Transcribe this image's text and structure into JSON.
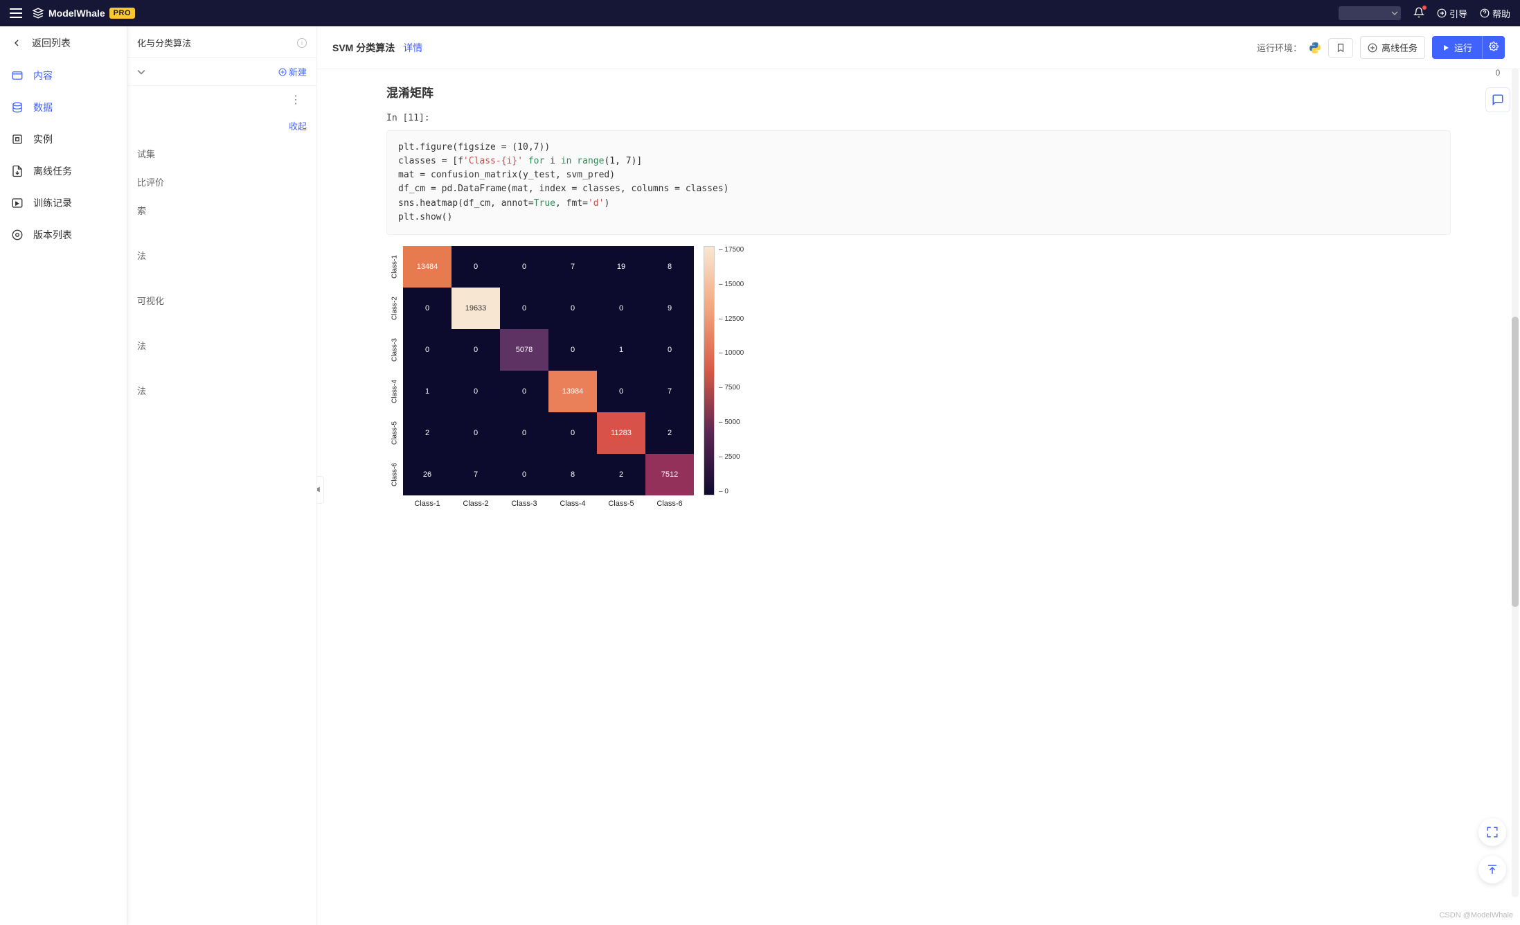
{
  "topbar": {
    "brand": "ModelWhale",
    "pro": "PRO",
    "guide": "引导",
    "help": "帮助"
  },
  "drawer": {
    "back": "返回列表",
    "items": [
      {
        "label": "内容",
        "active": true
      },
      {
        "label": "数据",
        "active": true
      },
      {
        "label": "实例",
        "active": false
      },
      {
        "label": "离线任务",
        "active": false
      },
      {
        "label": "训练记录",
        "active": false
      },
      {
        "label": "版本列表",
        "active": false
      }
    ]
  },
  "outline": {
    "title_suffix": "化与分类算法",
    "new_btn": "新建",
    "collapse": "收起",
    "items": [
      "试集",
      "比评价",
      "索",
      "法",
      "可视化",
      "法",
      "法"
    ]
  },
  "main": {
    "title": "SVM 分类算法",
    "detail": "详情",
    "env_label": "运行环境：",
    "offline_btn": "离线任务",
    "run_btn": "运行"
  },
  "notebook": {
    "heading": "混淆矩阵",
    "in_label": "In [11]:",
    "code_tokens": [
      {
        "t": "plt.figure(figsize = (",
        "c": ""
      },
      {
        "t": "10",
        "c": ""
      },
      {
        "t": ",",
        "c": ""
      },
      {
        "t": "7",
        "c": ""
      },
      {
        "t": "))\n",
        "c": ""
      },
      {
        "t": "classes = [f",
        "c": ""
      },
      {
        "t": "'Class-{i}'",
        "c": "s"
      },
      {
        "t": " ",
        "c": ""
      },
      {
        "t": "for",
        "c": "k"
      },
      {
        "t": " i ",
        "c": ""
      },
      {
        "t": "in",
        "c": "k"
      },
      {
        "t": " ",
        "c": ""
      },
      {
        "t": "range",
        "c": "b"
      },
      {
        "t": "(",
        "c": ""
      },
      {
        "t": "1",
        "c": ""
      },
      {
        "t": ", ",
        "c": ""
      },
      {
        "t": "7",
        "c": ""
      },
      {
        "t": ")]\n",
        "c": ""
      },
      {
        "t": "mat = confusion_matrix(y_test, svm_pred)\n",
        "c": ""
      },
      {
        "t": "df_cm = pd.DataFrame(mat, index = classes, columns = classes)\n",
        "c": ""
      },
      {
        "t": "sns.heatmap(df_cm, annot=",
        "c": ""
      },
      {
        "t": "True",
        "c": "b"
      },
      {
        "t": ", fmt=",
        "c": ""
      },
      {
        "t": "'d'",
        "c": "s"
      },
      {
        "t": ")\n",
        "c": ""
      },
      {
        "t": "plt.show()",
        "c": ""
      }
    ]
  },
  "rail": {
    "comment_count": "0"
  },
  "watermark": "CSDN @ModelWhale",
  "chart_data": {
    "type": "heatmap",
    "title": "",
    "xlabel": "",
    "ylabel": "",
    "x_categories": [
      "Class-1",
      "Class-2",
      "Class-3",
      "Class-4",
      "Class-5",
      "Class-6"
    ],
    "y_categories": [
      "Class-1",
      "Class-2",
      "Class-3",
      "Class-4",
      "Class-5",
      "Class-6"
    ],
    "values": [
      [
        13484,
        0,
        0,
        7,
        19,
        8
      ],
      [
        0,
        19633,
        0,
        0,
        0,
        9
      ],
      [
        0,
        0,
        5078,
        0,
        1,
        0
      ],
      [
        1,
        0,
        0,
        13984,
        0,
        7
      ],
      [
        2,
        0,
        0,
        0,
        11283,
        2
      ],
      [
        26,
        7,
        0,
        8,
        2,
        7512
      ]
    ],
    "colorbar_ticks": [
      17500,
      15000,
      12500,
      10000,
      7500,
      5000,
      2500,
      0
    ],
    "vmin": 0,
    "vmax": 19633,
    "cell_colors": [
      [
        "#e77a4e",
        "#0d0b2d",
        "#0d0b2d",
        "#0d0b2d",
        "#0d0b2d",
        "#0d0b2d"
      ],
      [
        "#0d0b2d",
        "#f7e6d2",
        "#0d0b2d",
        "#0d0b2d",
        "#0d0b2d",
        "#0d0b2d"
      ],
      [
        "#0d0b2d",
        "#0d0b2d",
        "#5c3362",
        "#0d0b2d",
        "#0d0b2d",
        "#0d0b2d"
      ],
      [
        "#0d0b2d",
        "#0d0b2d",
        "#0d0b2d",
        "#ea8059",
        "#0d0b2d",
        "#0d0b2d"
      ],
      [
        "#0d0b2d",
        "#0d0b2d",
        "#0d0b2d",
        "#0d0b2d",
        "#d9524a",
        "#0d0b2d"
      ],
      [
        "#0d0b2d",
        "#0d0b2d",
        "#0d0b2d",
        "#0d0b2d",
        "#0d0b2d",
        "#94315a"
      ]
    ],
    "text_colors": [
      [
        "#fff",
        "#fff",
        "#fff",
        "#fff",
        "#fff",
        "#fff"
      ],
      [
        "#fff",
        "#333",
        "#fff",
        "#fff",
        "#fff",
        "#fff"
      ],
      [
        "#fff",
        "#fff",
        "#fff",
        "#fff",
        "#fff",
        "#fff"
      ],
      [
        "#fff",
        "#fff",
        "#fff",
        "#fff",
        "#fff",
        "#fff"
      ],
      [
        "#fff",
        "#fff",
        "#fff",
        "#fff",
        "#fff",
        "#fff"
      ],
      [
        "#fff",
        "#fff",
        "#fff",
        "#fff",
        "#fff",
        "#fff"
      ]
    ]
  }
}
